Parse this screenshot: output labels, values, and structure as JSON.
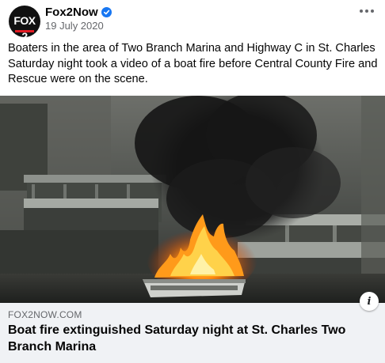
{
  "post": {
    "avatar_logo_text": "FOX 2",
    "page_name": "Fox2Now",
    "verified_icon": "verified-badge-icon",
    "date": "19 July 2020",
    "more_icon": "more-options-icon",
    "text": "Boaters in the area of Two Branch Marina and Highway C in St. Charles Saturday night took a video of a boat fire before Central County Fire and Rescue were on the scene."
  },
  "photo": {
    "subject": "boat-fire-photo"
  },
  "link_preview": {
    "domain": "FOX2NOW.COM",
    "title": "Boat fire extinguished Saturday night at St. Charles Two Branch Marina",
    "info_icon": "info-icon",
    "info_label": "i"
  },
  "colors": {
    "accent_blue": "#1877f2",
    "secondary_text": "#65676b",
    "preview_bg": "#f0f2f5",
    "fox_red": "#e21b23"
  }
}
